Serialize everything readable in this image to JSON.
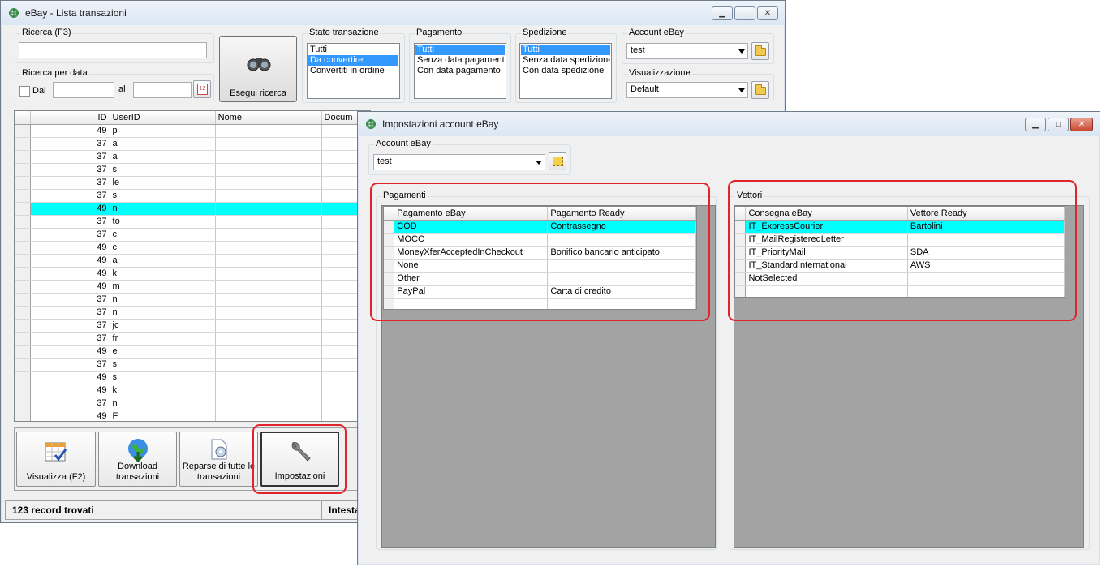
{
  "main": {
    "title": "eBay - Lista transazioni",
    "search_label": "Ricerca (F3)",
    "search_value": "",
    "date_group_label": "Ricerca per data",
    "date_from_label": "Dal",
    "date_to_label": "al",
    "calendar_num": "12",
    "search_button": "Esegui ricerca",
    "stato": {
      "label": "Stato transazione",
      "items": [
        "Tutti",
        "Da convertire",
        "Convertiti in ordine"
      ],
      "selected": 1
    },
    "pagamento": {
      "label": "Pagamento",
      "items": [
        "Tutti",
        "Senza data pagamento",
        "Con data pagamento"
      ],
      "selected": 0
    },
    "spedizione": {
      "label": "Spedizione",
      "items": [
        "Tutti",
        "Senza data spedizione",
        "Con data spedizione"
      ],
      "selected": 0
    },
    "account": {
      "label": "Account eBay",
      "value": "test"
    },
    "visualizzazione": {
      "label": "Visualizzazione",
      "value": "Default"
    },
    "grid": {
      "columns": [
        "ID",
        "UserID",
        "Nome",
        "Docum"
      ],
      "rows": [
        [
          "49",
          "p"
        ],
        [
          "37",
          "a"
        ],
        [
          "37",
          "a"
        ],
        [
          "37",
          "s"
        ],
        [
          "37",
          "le"
        ],
        [
          "37",
          "s"
        ],
        [
          "49",
          "n"
        ],
        [
          "37",
          "to"
        ],
        [
          "37",
          "c"
        ],
        [
          "49",
          "c"
        ],
        [
          "49",
          "a"
        ],
        [
          "49",
          "k"
        ],
        [
          "49",
          "m"
        ],
        [
          "37",
          "n"
        ],
        [
          "37",
          "n"
        ],
        [
          "37",
          "jc"
        ],
        [
          "37",
          "fr"
        ],
        [
          "49",
          "e"
        ],
        [
          "37",
          "s"
        ],
        [
          "49",
          "s"
        ],
        [
          "49",
          "k"
        ],
        [
          "37",
          "n"
        ],
        [
          "49",
          "F"
        ]
      ],
      "selected_row": 6
    },
    "buttons": {
      "visualizza": "Visualizza (F2)",
      "download": "Download transazioni",
      "reparse": "Reparse di tutte le transazioni",
      "impostazioni": "Impostazioni"
    },
    "status_records": "123 record trovati",
    "status_right": "Intesta"
  },
  "dialog": {
    "title": "Impostazioni account eBay",
    "account_label": "Account eBay",
    "account_value": "test",
    "pagamenti": {
      "label": "Pagamenti",
      "columns": [
        "Pagamento eBay",
        "Pagamento Ready"
      ],
      "rows": [
        [
          "COD",
          "Contrassegno"
        ],
        [
          "MOCC",
          ""
        ],
        [
          "MoneyXferAcceptedInCheckout",
          "Bonifico bancario anticipato"
        ],
        [
          "None",
          ""
        ],
        [
          "Other",
          ""
        ],
        [
          "PayPal",
          "Carta di credito"
        ],
        [
          "",
          ""
        ]
      ],
      "selected_row": 0
    },
    "vettori": {
      "label": "Vettori",
      "columns": [
        "Consegna eBay",
        "Vettore Ready"
      ],
      "rows": [
        [
          "IT_ExpressCourier",
          "Bartolini"
        ],
        [
          "IT_MailRegisteredLetter",
          ""
        ],
        [
          "IT_PriorityMail",
          "SDA"
        ],
        [
          "IT_StandardInternational",
          "AWS"
        ],
        [
          "NotSelected",
          ""
        ],
        [
          "",
          ""
        ]
      ],
      "selected_row": 0
    }
  },
  "colors": {
    "selection": "#00ffff",
    "highlight": "#e0242b",
    "list_selection": "#3399ff"
  }
}
